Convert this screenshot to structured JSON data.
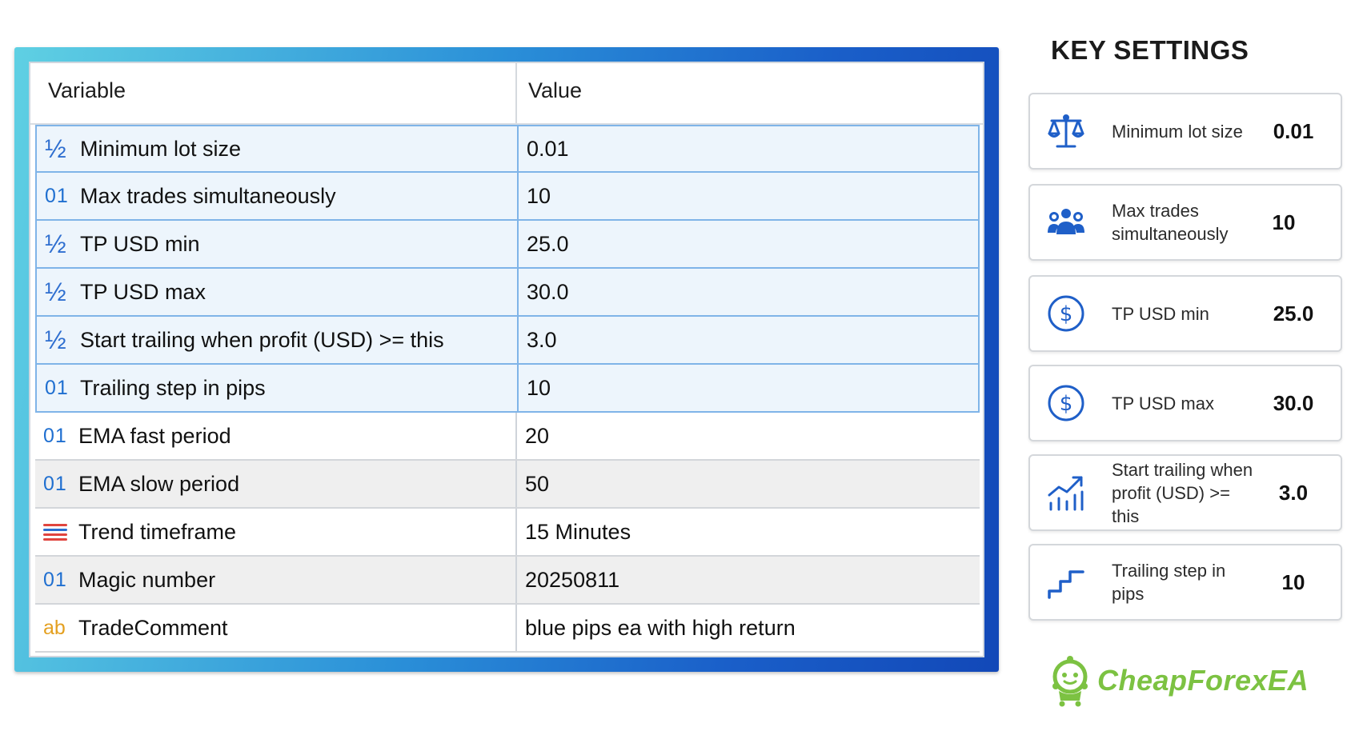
{
  "table": {
    "col_variable": "Variable",
    "col_value": "Value",
    "rows": [
      {
        "icon": "½",
        "label": "Minimum lot size",
        "value": "0.01"
      },
      {
        "icon": "01",
        "label": "Max trades simultaneously",
        "value": "10"
      },
      {
        "icon": "½",
        "label": "TP USD min",
        "value": "25.0"
      },
      {
        "icon": "½",
        "label": "TP USD max",
        "value": "30.0"
      },
      {
        "icon": "½",
        "label": "Start trailing when profit (USD) >= this",
        "value": "3.0"
      },
      {
        "icon": "01",
        "label": "Trailing step in pips",
        "value": "10"
      },
      {
        "icon": "01",
        "label": "EMA fast period",
        "value": "20"
      },
      {
        "icon": "01",
        "label": "EMA slow period",
        "value": "50"
      },
      {
        "icon": "list-icon",
        "label": "Trend timeframe",
        "value": "15 Minutes"
      },
      {
        "icon": "01",
        "label": "Magic number",
        "value": "20250811"
      },
      {
        "icon": "ab",
        "label": "TradeComment",
        "value": "blue pips ea with high return"
      }
    ]
  },
  "key_settings": {
    "title": "KEY SETTINGS",
    "cards": [
      {
        "icon": "balance-scale-icon",
        "label": "Minimum lot size",
        "value": "0.01"
      },
      {
        "icon": "users-icon",
        "label": "Max trades simultaneously",
        "value": "10"
      },
      {
        "icon": "dollar-circle-icon",
        "label": "TP USD min",
        "value": "25.0"
      },
      {
        "icon": "dollar-circle-icon",
        "label": "TP USD max",
        "value": "30.0"
      },
      {
        "icon": "trend-up-icon",
        "label": "Start trailing when profit (USD) >= this",
        "value": "3.0"
      },
      {
        "icon": "steps-icon",
        "label": "Trailing step in pips",
        "value": "10"
      }
    ]
  },
  "logo": {
    "text": "CheapForexEA"
  },
  "colors": {
    "accent": "#1f6fd0",
    "highlight_row": "#edf5fc",
    "logo_green": "#7cc242"
  }
}
